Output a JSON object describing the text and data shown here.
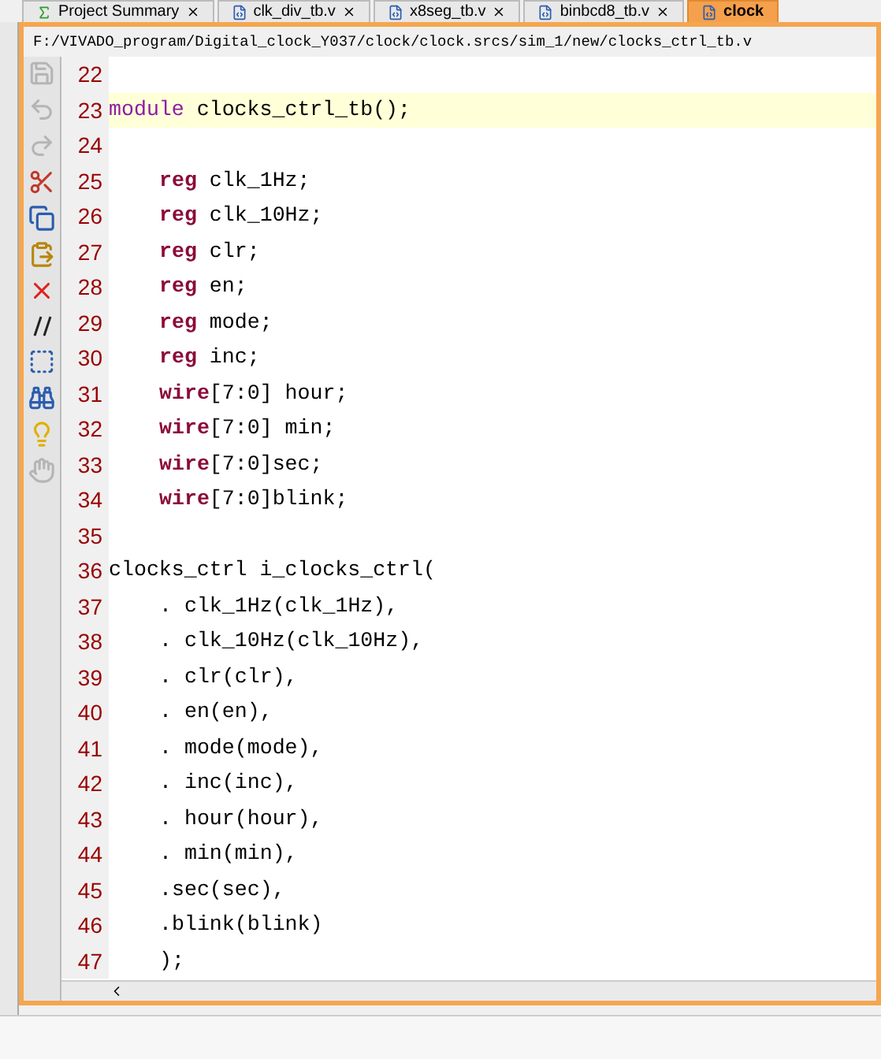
{
  "tabs": [
    {
      "label": "Project Summary",
      "kind": "summary",
      "selected": false
    },
    {
      "label": "clk_div_tb.v",
      "kind": "file",
      "selected": false
    },
    {
      "label": "x8seg_tb.v",
      "kind": "file",
      "selected": false
    },
    {
      "label": "binbcd8_tb.v",
      "kind": "file",
      "selected": false
    },
    {
      "label": "clock",
      "kind": "file",
      "selected": true
    }
  ],
  "file_path": "F:/VIVADO_program/Digital_clock_Y037/clock/clock.srcs/sim_1/new/clocks_ctrl_tb.v",
  "toolbar": [
    {
      "kind": "save",
      "disabled": true
    },
    {
      "kind": "undo",
      "disabled": true
    },
    {
      "kind": "redo",
      "disabled": true
    },
    {
      "kind": "cut",
      "disabled": false
    },
    {
      "kind": "copy",
      "disabled": false
    },
    {
      "kind": "paste",
      "disabled": false
    },
    {
      "kind": "delete",
      "disabled": false
    },
    {
      "kind": "comment",
      "disabled": false
    },
    {
      "kind": "block",
      "disabled": false
    },
    {
      "kind": "find",
      "disabled": false
    },
    {
      "kind": "hint",
      "disabled": false
    },
    {
      "kind": "hand",
      "disabled": true
    }
  ],
  "lines": [
    {
      "number": "22",
      "current": false
    },
    {
      "number": "23",
      "current": true,
      "indent": false,
      "tokens": [
        {
          "kind": "module",
          "text": "module"
        },
        {
          "kind": "plain",
          "text": " clocks_ctrl_tb();"
        }
      ]
    },
    {
      "number": "24",
      "current": false
    },
    {
      "number": "25",
      "current": false,
      "indent": true,
      "tokens": [
        {
          "kind": "keyword",
          "text": "reg"
        },
        {
          "kind": "plain",
          "text": " clk_1Hz;"
        }
      ]
    },
    {
      "number": "26",
      "current": false,
      "indent": true,
      "tokens": [
        {
          "kind": "keyword",
          "text": "reg"
        },
        {
          "kind": "plain",
          "text": " clk_10Hz;"
        }
      ]
    },
    {
      "number": "27",
      "current": false,
      "indent": true,
      "tokens": [
        {
          "kind": "keyword",
          "text": "reg"
        },
        {
          "kind": "plain",
          "text": " clr;"
        }
      ]
    },
    {
      "number": "28",
      "current": false,
      "indent": true,
      "tokens": [
        {
          "kind": "keyword",
          "text": "reg"
        },
        {
          "kind": "plain",
          "text": " en;"
        }
      ]
    },
    {
      "number": "29",
      "current": false,
      "indent": true,
      "tokens": [
        {
          "kind": "keyword",
          "text": "reg"
        },
        {
          "kind": "plain",
          "text": " mode;"
        }
      ]
    },
    {
      "number": "30",
      "current": false,
      "indent": true,
      "tokens": [
        {
          "kind": "keyword",
          "text": "reg"
        },
        {
          "kind": "plain",
          "text": " inc;"
        }
      ]
    },
    {
      "number": "31",
      "current": false,
      "indent": true,
      "tokens": [
        {
          "kind": "keyword",
          "text": "wire"
        },
        {
          "kind": "plain",
          "text": "[7:0] hour;"
        }
      ]
    },
    {
      "number": "32",
      "current": false,
      "indent": true,
      "tokens": [
        {
          "kind": "keyword",
          "text": "wire"
        },
        {
          "kind": "plain",
          "text": "[7:0] min;"
        }
      ]
    },
    {
      "number": "33",
      "current": false,
      "indent": true,
      "tokens": [
        {
          "kind": "keyword",
          "text": "wire"
        },
        {
          "kind": "plain",
          "text": "[7:0]sec;"
        }
      ]
    },
    {
      "number": "34",
      "current": false,
      "indent": true,
      "tokens": [
        {
          "kind": "keyword",
          "text": "wire"
        },
        {
          "kind": "plain",
          "text": "[7:0]blink;"
        }
      ]
    },
    {
      "number": "35",
      "current": false
    },
    {
      "number": "36",
      "current": false,
      "indent": false,
      "tokens": [
        {
          "kind": "plain",
          "text": "clocks_ctrl i_clocks_ctrl("
        }
      ]
    },
    {
      "number": "37",
      "current": false,
      "indent": true,
      "tokens": [
        {
          "kind": "plain",
          "text": ". clk_1Hz(clk_1Hz),"
        }
      ]
    },
    {
      "number": "38",
      "current": false,
      "indent": true,
      "tokens": [
        {
          "kind": "plain",
          "text": ". clk_10Hz(clk_10Hz),"
        }
      ]
    },
    {
      "number": "39",
      "current": false,
      "indent": true,
      "tokens": [
        {
          "kind": "plain",
          "text": ". clr(clr),"
        }
      ]
    },
    {
      "number": "40",
      "current": false,
      "indent": true,
      "tokens": [
        {
          "kind": "plain",
          "text": ". en(en),"
        }
      ]
    },
    {
      "number": "41",
      "current": false,
      "indent": true,
      "tokens": [
        {
          "kind": "plain",
          "text": ". mode(mode),"
        }
      ]
    },
    {
      "number": "42",
      "current": false,
      "indent": true,
      "tokens": [
        {
          "kind": "plain",
          "text": ". inc(inc),"
        }
      ]
    },
    {
      "number": "43",
      "current": false,
      "indent": true,
      "tokens": [
        {
          "kind": "plain",
          "text": ". hour(hour),"
        }
      ]
    },
    {
      "number": "44",
      "current": false,
      "indent": true,
      "tokens": [
        {
          "kind": "plain",
          "text": ". min(min),"
        }
      ]
    },
    {
      "number": "45",
      "current": false,
      "indent": true,
      "tokens": [
        {
          "kind": "plain",
          "text": ".sec(sec),"
        }
      ]
    },
    {
      "number": "46",
      "current": false,
      "indent": true,
      "tokens": [
        {
          "kind": "plain",
          "text": ".blink(blink)"
        }
      ]
    },
    {
      "number": "47",
      "current": false,
      "indent": true,
      "tokens": [
        {
          "kind": "plain",
          "text": ");"
        }
      ]
    }
  ]
}
